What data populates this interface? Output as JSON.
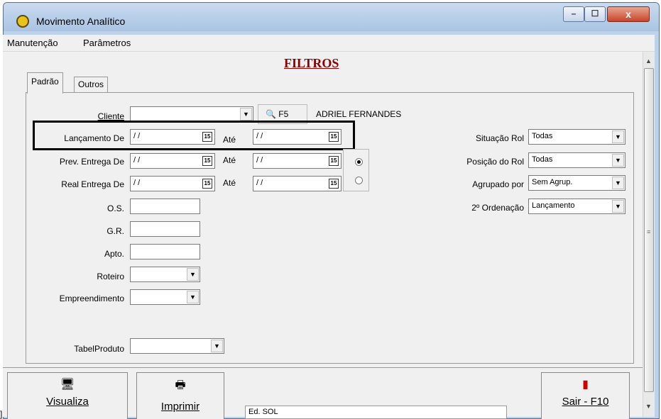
{
  "window": {
    "title": "Movimento Analítico",
    "min": "–",
    "max": "☐",
    "close": "x"
  },
  "menu": [
    "Manutenção",
    "Parâmetros"
  ],
  "heading": "FILTROS",
  "tabs": {
    "active": "Padrão",
    "other": "Outros"
  },
  "cliente": {
    "label": "Cliente",
    "value": "",
    "search_label": "F5",
    "client_name": "ADRIEL FERNANDES"
  },
  "lancamento": {
    "label": "Lançamento De",
    "from": "/ /",
    "to_label": "Até",
    "to": "/ /"
  },
  "prev_entrega": {
    "label": "Prev. Entrega De",
    "from": "/ /",
    "to_label": "Até",
    "to": "/ /"
  },
  "real_entrega": {
    "label": "Real Entrega De",
    "from": "/ /",
    "to_label": "Até",
    "to": "/ /"
  },
  "date_icon": "15",
  "os": {
    "label": "O.S.",
    "value": ""
  },
  "gr": {
    "label": "G.R.",
    "value": ""
  },
  "apto": {
    "label": "Apto.",
    "value": ""
  },
  "roteiro": {
    "label": "Roteiro",
    "value": ""
  },
  "empreendimento": {
    "label": "Empreendimento",
    "value": ""
  },
  "tabelproduto": {
    "label": "TabelProduto",
    "value": ""
  },
  "situacao_rol": {
    "label": "Situação Rol",
    "value": "Todas"
  },
  "posicao_rol": {
    "label": "Posição do Rol",
    "value": "Todas"
  },
  "agrupado_por": {
    "label": "Agrupado por",
    "value": "Sem Agrup."
  },
  "ordenacao": {
    "label": "2º Ordenação",
    "value": "Lançamento"
  },
  "radio_selected": 0,
  "buttons": {
    "visualiza": "Visualiza",
    "imprimir": "Imprimir",
    "sair": "Sair - F10"
  },
  "status_text": "Ed. SOL",
  "stray_char": "]"
}
